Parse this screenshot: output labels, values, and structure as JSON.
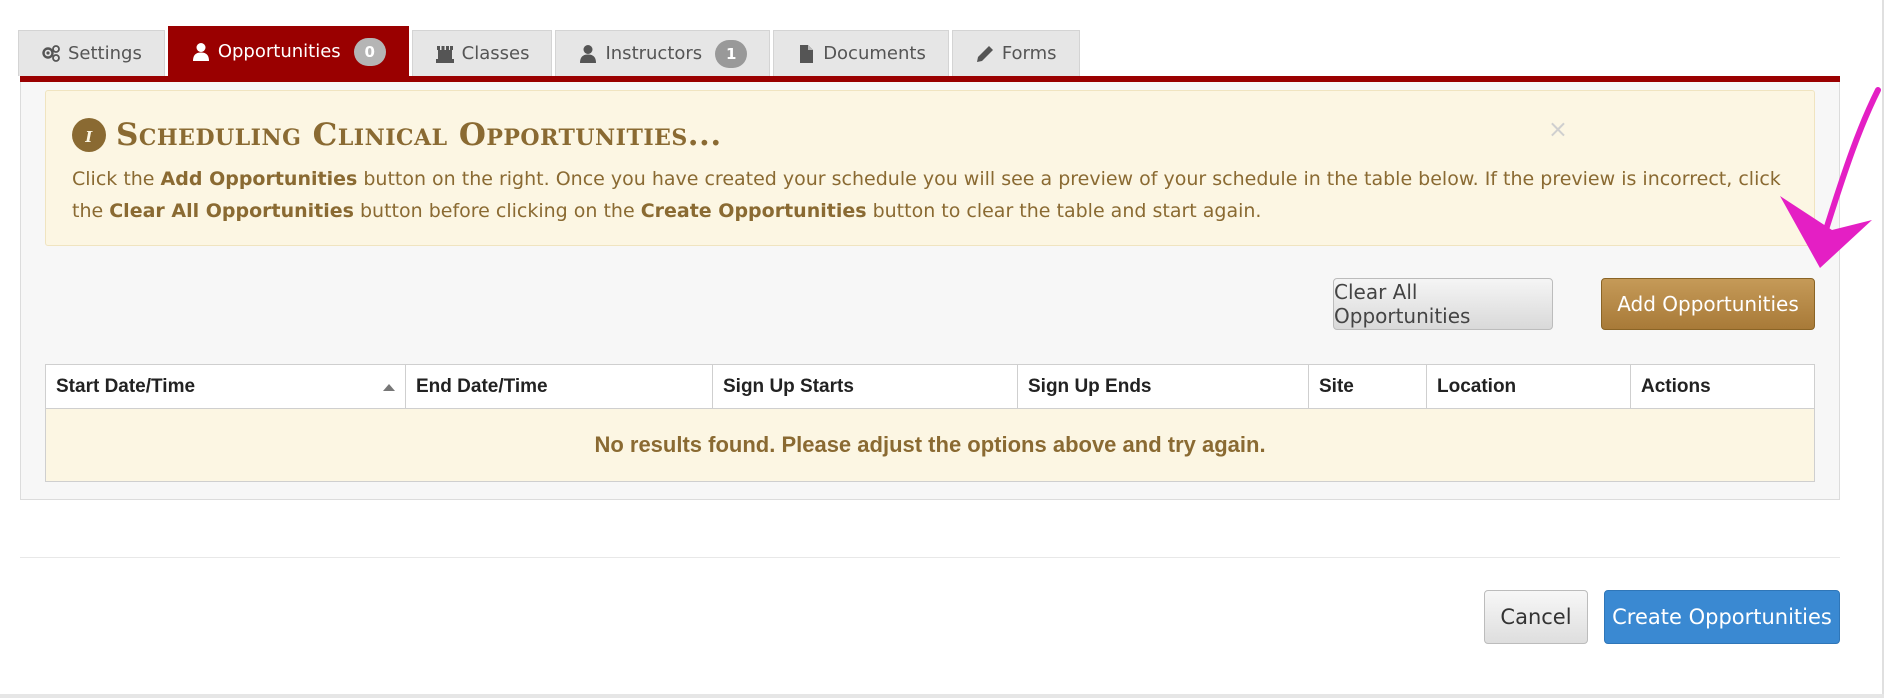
{
  "tabs": [
    {
      "label": "Settings",
      "icon": "gears-icon",
      "badge": null,
      "active": false
    },
    {
      "label": "Opportunities",
      "icon": "user-icon",
      "badge": "0",
      "active": true
    },
    {
      "label": "Classes",
      "icon": "classes-icon",
      "badge": null,
      "active": false
    },
    {
      "label": "Instructors",
      "icon": "user-icon",
      "badge": "1",
      "active": false
    },
    {
      "label": "Documents",
      "icon": "document-icon",
      "badge": null,
      "active": false
    },
    {
      "label": "Forms",
      "icon": "pencil-icon",
      "badge": null,
      "active": false
    }
  ],
  "alert": {
    "title": "Scheduling Clinical Opportunities...",
    "close": "×",
    "body_parts": [
      "Click the ",
      "Add Opportunities",
      " button on the right. Once you have created your schedule you will see a preview of your schedule in the table below. If the preview is incorrect, click the ",
      "Clear All Opportunities",
      " button before clicking on the ",
      "Create Opportunities",
      " button to clear the table and start again."
    ]
  },
  "buttons": {
    "clear_all": "Clear All Opportunities",
    "add": "Add Opportunities",
    "cancel": "Cancel",
    "create": "Create Opportunities"
  },
  "table": {
    "columns": [
      "Start Date/Time",
      "End Date/Time",
      "Sign Up Starts",
      "Sign Up Ends",
      "Site",
      "Location",
      "Actions"
    ],
    "empty_message": "No results found. Please adjust the options above and try again."
  },
  "colors": {
    "tab_active": "#9a0000",
    "alert_bg": "#fcf6e3",
    "alert_text": "#8a6a32",
    "add_button": "#b0843f",
    "create_button": "#3a89d2",
    "annotation_arrow": "#e41fc4"
  }
}
